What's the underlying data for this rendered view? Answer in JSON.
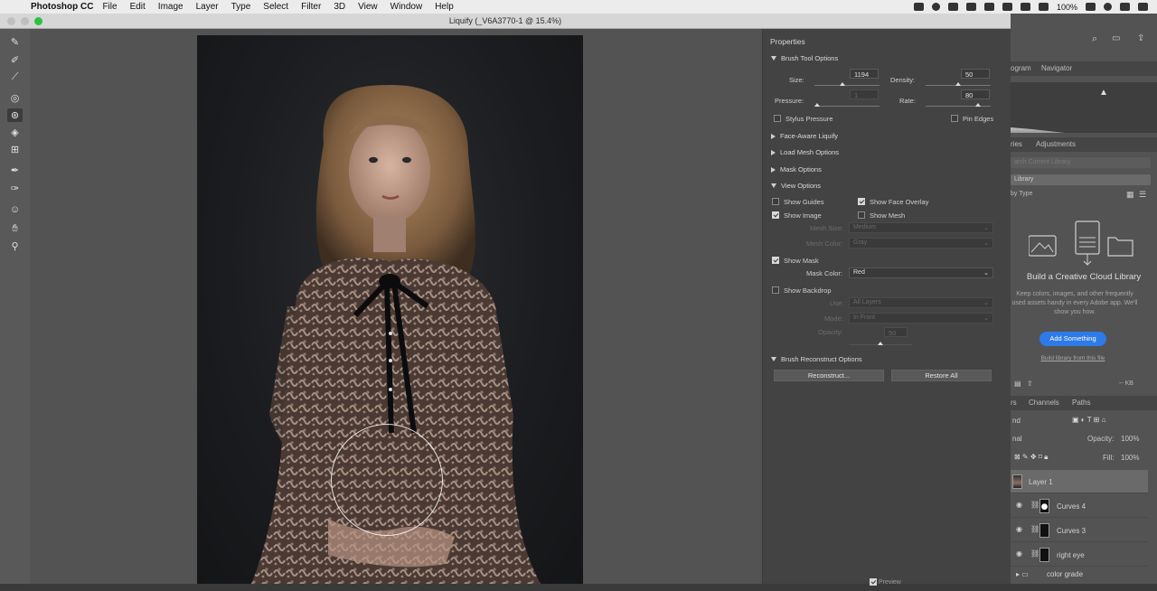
{
  "menubar": {
    "app_name": "Photoshop CC",
    "menus": [
      "File",
      "Edit",
      "Image",
      "Layer",
      "Type",
      "Select",
      "Filter",
      "3D",
      "View",
      "Window",
      "Help"
    ],
    "battery": "100%"
  },
  "window": {
    "title": "Liquify (_V6A3770-1 @ 15.4%)"
  },
  "tools": [
    "forward-warp-icon",
    "reconstruct-icon",
    "smooth-icon",
    "twirl-icon",
    "pucker-icon",
    "bloat-icon",
    "push-left-icon",
    "freeze-mask-icon",
    "thaw-mask-icon",
    "face-tool-icon",
    "hand-icon",
    "zoom-icon"
  ],
  "properties": {
    "header": "Properties",
    "brush_tool_options": {
      "title": "Brush Tool Options",
      "size_label": "Size:",
      "size_value": "1194",
      "density_label": "Density:",
      "density_value": "50",
      "pressure_label": "Pressure:",
      "pressure_value": "1",
      "rate_label": "Rate:",
      "rate_value": "80",
      "stylus_pressure": "Stylus Pressure",
      "pin_edges": "Pin Edges"
    },
    "face_aware": "Face-Aware Liquify",
    "load_mesh": "Load Mesh Options",
    "mask_options": "Mask Options",
    "view_options": {
      "title": "View Options",
      "show_guides": "Show Guides",
      "show_face_overlay": "Show Face Overlay",
      "show_image": "Show Image",
      "show_mesh": "Show Mesh",
      "mesh_size_label": "Mesh Size:",
      "mesh_size_value": "Medium",
      "mesh_color_label": "Mesh Color:",
      "mesh_color_value": "Gray",
      "show_mask": "Show Mask",
      "mask_color_label": "Mask Color:",
      "mask_color_value": "Red",
      "show_backdrop": "Show Backdrop",
      "use_label": "Use:",
      "use_value": "All Layers",
      "mode_label": "Mode:",
      "mode_value": "In Front",
      "opacity_label": "Opacity:",
      "opacity_value": "50"
    },
    "brush_reconstruct": {
      "title": "Brush Reconstruct Options",
      "reconstruct_btn": "Reconstruct...",
      "restore_btn": "Restore All"
    },
    "preview": "Preview"
  },
  "right_panel": {
    "tabs_top": [
      "ogram",
      "Navigator"
    ],
    "tabs_lib": [
      "ries",
      "Adjustments"
    ],
    "search_placeholder": "arch Current Library",
    "library_select": "Library",
    "by_type": "by Type",
    "cc_title": "Build a Creative Cloud Library",
    "cc_desc": "Keep colors, images, and other frequently used assets handy in every Adobe app. We'll show you how.",
    "add_button": "Add Something",
    "build_link": "Build library from this file",
    "lib_size": "-- KB",
    "tabs_layers": [
      "rs",
      "Channels",
      "Paths"
    ],
    "kind_label": "nd",
    "blend_mode": "nal",
    "opacity_label": "Opacity:",
    "opacity_value": "100%",
    "fill_label": "Fill:",
    "fill_value": "100%",
    "layers": [
      "Layer 1",
      "Curves 4",
      "Curves 3",
      "right eye",
      "color grade"
    ]
  },
  "colors": {
    "accent_blue": "#2d7ae8",
    "window_green": "#29c240",
    "panel_bg": "#434343"
  }
}
